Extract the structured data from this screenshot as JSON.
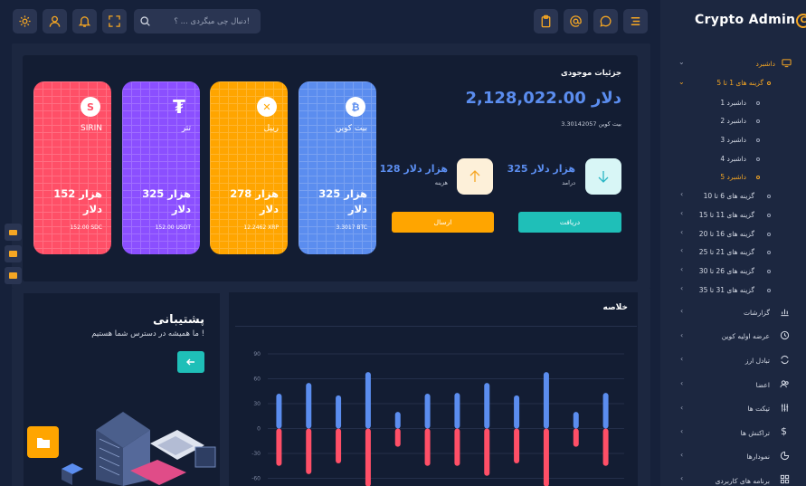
{
  "brand": {
    "name": "Crypto Admin",
    "coin_glyph": "C"
  },
  "header": {
    "search_placeholder": "دنبال چی میگردی ... ؟!",
    "right_icons": [
      "menu-icon",
      "chat-icon",
      "at-icon",
      "clipboard-icon"
    ],
    "left_icons": [
      "settings-icon",
      "user-icon",
      "bell-icon",
      "fullscreen-icon"
    ]
  },
  "sidebar": {
    "dashboard": "داشبرد",
    "group_1_5": "گزینه های 1 تا 5",
    "sub": [
      "داشبرد 1",
      "داشبرد 2",
      "داشبرد 3",
      "داشبرد 4",
      "داشبرد 5"
    ],
    "groups": [
      "گزینه های 6 تا 10",
      "گزینه های 11 تا 15",
      "گزینه های 16 تا 20",
      "گزینه های 21 تا 25",
      "گزینه های 26 تا 30",
      "گزینه های 31 تا 35"
    ],
    "menu": [
      "گزارشات",
      "عرضه اولیه کوین",
      "تبادل ارز",
      "اعضا",
      "تیکت ها",
      "تراکنش ها",
      "نمودارها",
      "برنامه های کاربردی"
    ]
  },
  "balance": {
    "title": "جزئیات موجودی",
    "total": "2,128,022.00 دلار",
    "btc_total": "3.30142057 بیت کوین",
    "income_amount": "325 هزار دلار",
    "income_label": "درامد",
    "expense_amount": "128 هزار دلار",
    "expense_label": "هزینه",
    "receive_button": "دریافت",
    "send_button": "ارسال"
  },
  "cards": [
    {
      "name": "بیت کوین",
      "amount": "325 هزار دلار",
      "sub": "3.3017 BTC",
      "color": "#5b8def",
      "icon": "bitcoin-icon",
      "glyph": "₿"
    },
    {
      "name": "ریپل",
      "amount": "278 هزار دلار",
      "sub": "12.2462 XRP",
      "color": "#ffa500",
      "icon": "ripple-icon",
      "glyph": "✕"
    },
    {
      "name": "تتر",
      "amount": "325 هزار دلار",
      "sub": "152.00 USDT",
      "color": "#8b4fff",
      "icon": "tether-icon",
      "glyph": "₮"
    },
    {
      "name": "SIRIN",
      "amount": "152 هزار دلار",
      "sub": "152.00 SDC",
      "color": "#ff4f67",
      "icon": "sirin-icon",
      "glyph": "S"
    }
  ],
  "summary": {
    "title": "خلاصه"
  },
  "support": {
    "title": "پشتیبانی",
    "subtitle": "ما همیشه در دسترس شما هستیم !"
  },
  "chart_data": {
    "type": "bar",
    "title": "",
    "ylim": [
      -60,
      90
    ],
    "yticks": [
      90,
      60,
      30,
      0,
      -30,
      -60
    ],
    "series": [
      {
        "values": [
          42,
          55,
          40,
          68,
          20,
          42,
          43,
          55,
          40,
          68,
          20,
          43
        ]
      },
      {
        "values": [
          -45,
          -55,
          -42,
          -70,
          -22,
          -45,
          -45,
          -57,
          -42,
          -70,
          -22,
          -45
        ]
      }
    ],
    "colors": [
      "#5b8def",
      "#ff4f67"
    ],
    "grid": true
  }
}
